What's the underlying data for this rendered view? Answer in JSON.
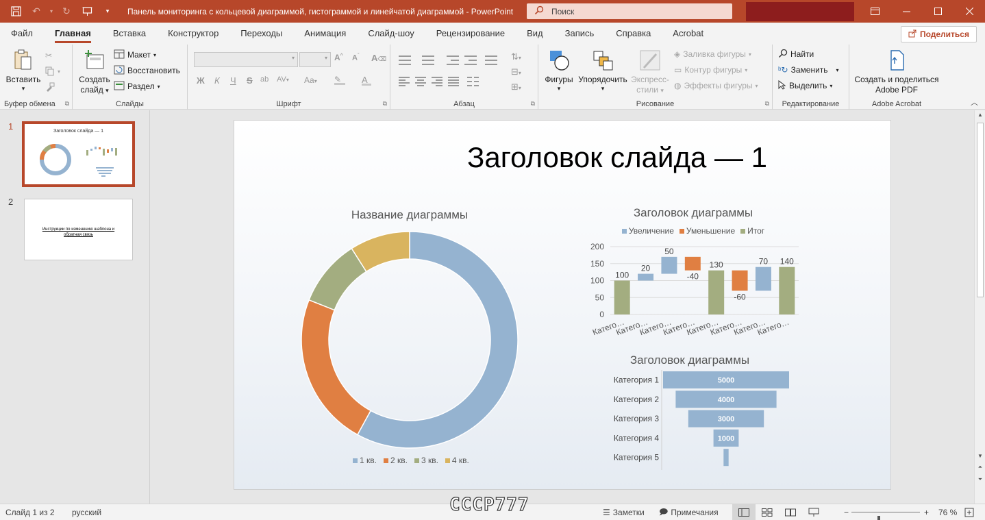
{
  "titlebar": {
    "doc_title": "Панель мониторинга с кольцевой диаграммой, гистограммой и линейчатой диаграммой  -  PowerPoint",
    "search_placeholder": "Поиск"
  },
  "tabs": [
    "Файл",
    "Главная",
    "Вставка",
    "Конструктор",
    "Переходы",
    "Анимация",
    "Слайд-шоу",
    "Рецензирование",
    "Вид",
    "Запись",
    "Справка",
    "Acrobat"
  ],
  "active_tab": "Главная",
  "share_label": "Поделиться",
  "ribbon": {
    "clipboard": {
      "label": "Буфер обмена",
      "paste": "Вставить"
    },
    "slides": {
      "label": "Слайды",
      "new_slide_1": "Создать",
      "new_slide_2": "слайд",
      "layout": "Макет",
      "reset": "Восстановить",
      "section": "Раздел"
    },
    "font": {
      "label": "Шрифт"
    },
    "paragraph": {
      "label": "Абзац"
    },
    "drawing": {
      "label": "Рисование",
      "shapes": "Фигуры",
      "arrange": "Упорядочить",
      "quick_styles_1": "Экспресс-",
      "quick_styles_2": "стили",
      "fill": "Заливка фигуры",
      "outline": "Контур фигуры",
      "effects": "Эффекты фигуры"
    },
    "editing": {
      "label": "Редактирование",
      "find": "Найти",
      "replace": "Заменить",
      "select": "Выделить"
    },
    "acrobat": {
      "label": "Adobe Acrobat",
      "create_1": "Создать и поделиться",
      "create_2": "Adobe PDF"
    }
  },
  "thumbnails": [
    {
      "num": "1",
      "title": "Заголовок слайда — 1"
    },
    {
      "num": "2",
      "text": "Инструкции по изменению шаблона и обратная связь"
    }
  ],
  "slide": {
    "title": "Заголовок слайда — 1"
  },
  "chart_data": [
    {
      "type": "pie",
      "subtype": "donut",
      "title": "Название диаграммы",
      "categories": [
        "1 кв.",
        "2 кв.",
        "3 кв.",
        "4 кв."
      ],
      "values": [
        58,
        23,
        10,
        9
      ],
      "colors": [
        "#95b3d0",
        "#e07f42",
        "#a3ad80",
        "#d9b45f"
      ],
      "legend": "bottom"
    },
    {
      "type": "bar",
      "subtype": "waterfall",
      "title": "Заголовок диаграммы",
      "legend_entries": [
        "Увеличение",
        "Уменьшение",
        "Итог"
      ],
      "legend_colors": [
        "#95b3d0",
        "#e07f42",
        "#a3ad80"
      ],
      "legend": "top",
      "categories": [
        "Катего…",
        "Катего…",
        "Катего…",
        "Катего…",
        "Катего…",
        "Катего…",
        "Катего…",
        "Катего…"
      ],
      "values": [
        100,
        20,
        50,
        -40,
        130,
        -60,
        70,
        140
      ],
      "labels": [
        "100",
        "20",
        "50",
        "-40",
        "130",
        "-60",
        "70",
        "140"
      ],
      "kinds": [
        "total",
        "increase",
        "increase",
        "decrease",
        "total",
        "decrease",
        "increase",
        "total"
      ],
      "ylim": [
        0,
        200
      ],
      "yticks": [
        "0",
        "50",
        "100",
        "150",
        "200"
      ],
      "grid": true
    },
    {
      "type": "bar",
      "subtype": "funnel",
      "title": "Заголовок диаграммы",
      "categories": [
        "Категория 1",
        "Категория 2",
        "Категория 3",
        "Категория 4",
        "Категория 5"
      ],
      "values": [
        5000,
        4000,
        3000,
        1000,
        200
      ],
      "labels": [
        "5000",
        "4000",
        "3000",
        "1000",
        ""
      ],
      "color": "#95b3d0"
    }
  ],
  "statusbar": {
    "slide_info": "Слайд 1 из 2",
    "language": "русский",
    "notes": "Заметки",
    "comments": "Примечания",
    "zoom": "76 %",
    "watermark": "CCCP777"
  },
  "colors": {
    "accent": "#b7472a",
    "account": "#8d1d1d"
  }
}
